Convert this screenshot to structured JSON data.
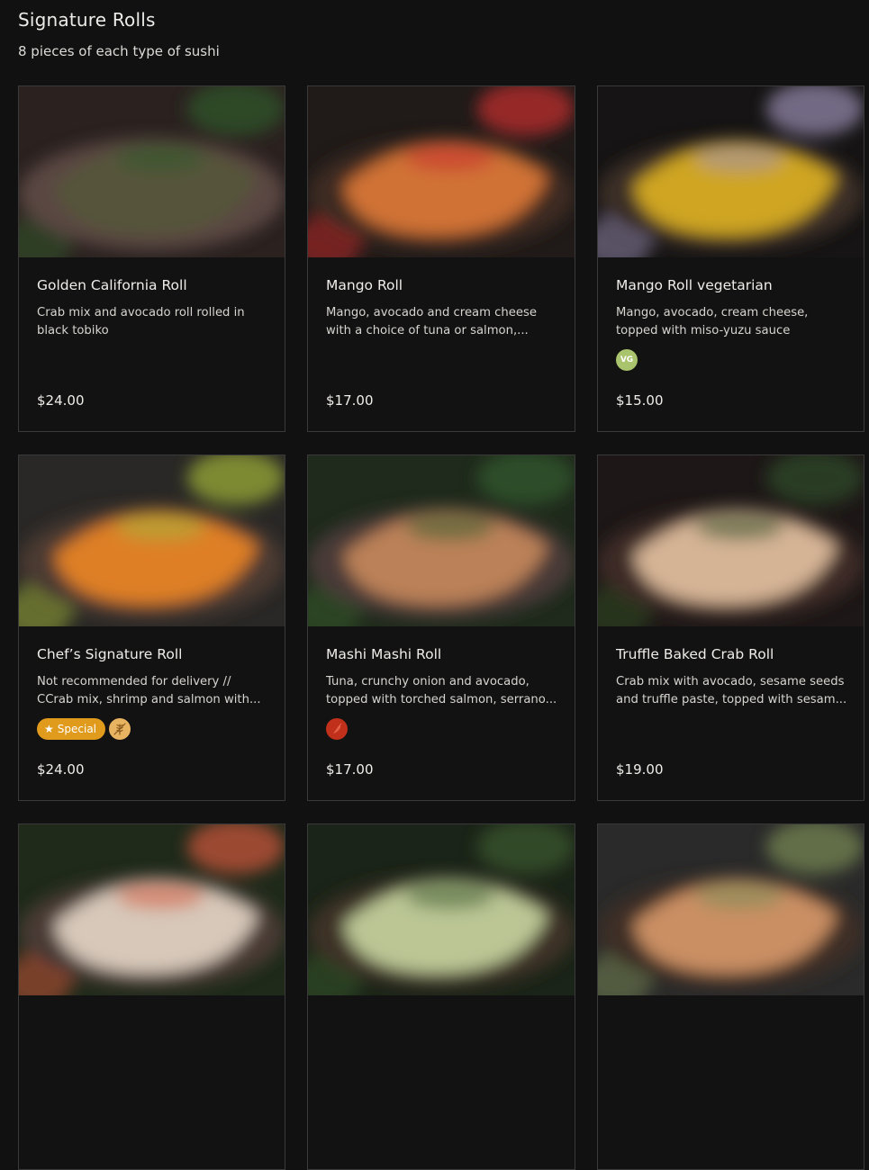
{
  "section": {
    "title": "Signature Rolls",
    "subtitle": "8 pieces of each type of sushi"
  },
  "items": [
    {
      "name": "Golden California Roll",
      "description": "Crab mix and avocado roll rolled in black tobiko",
      "price": "$24.00",
      "badges": [],
      "photo": {
        "bg": "#2b2220",
        "plate": "#5a4743",
        "food": "#57573a",
        "accent": "#2f5a2a"
      }
    },
    {
      "name": "Mango Roll",
      "description": "Mango, avocado and cream cheese with a choice of tuna or salmon,...",
      "price": "$17.00",
      "badges": [],
      "photo": {
        "bg": "#201b19",
        "plate": "#3d2a22",
        "food": "#e07a36",
        "accent": "#c92e2e"
      }
    },
    {
      "name": "Mango Roll vegetarian",
      "description": "Mango, avocado, cream cheese, topped with miso-yuzu sauce",
      "price": "$15.00",
      "badges": [
        {
          "type": "vg",
          "label": "VG",
          "icon": "vegetarian-icon"
        }
      ],
      "photo": {
        "bg": "#161414",
        "plate": "#3a2e28",
        "food": "#e0b322",
        "accent": "#9a8fb4"
      }
    },
    {
      "name": "Chef’s Signature Roll",
      "description": "Not recommended for delivery // CCrab mix, shrimp and salmon with...",
      "price": "$24.00",
      "badges": [
        {
          "type": "special",
          "label": "Special",
          "icon": "star-icon"
        },
        {
          "type": "gluten",
          "label": "",
          "icon": "wheat-icon"
        }
      ],
      "photo": {
        "bg": "#2a2826",
        "plate": "#4b3a32",
        "food": "#ee8727",
        "accent": "#a2b337"
      }
    },
    {
      "name": "Mashi Mashi Roll",
      "description": "Tuna, crunchy onion and avocado, topped with torched salmon, serrano...",
      "price": "$17.00",
      "badges": [
        {
          "type": "spicy",
          "label": "",
          "icon": "chili-pepper-icon"
        }
      ],
      "photo": {
        "bg": "#1f2a1c",
        "plate": "#4a3a38",
        "food": "#c88a5c",
        "accent": "#355c2c"
      }
    },
    {
      "name": "Truffle Baked Crab Roll",
      "description": "Crab mix with avocado, sesame seeds and truffle paste, topped with sesam...",
      "price": "$19.00",
      "badges": [],
      "photo": {
        "bg": "#1d1817",
        "plate": "#3e2b25",
        "food": "#e6c3a2",
        "accent": "#2f4d26"
      }
    },
    {
      "name": "",
      "description": "",
      "price": "",
      "badges": [],
      "photo": {
        "bg": "#1f2a1b",
        "plate": "#4a3a34",
        "food": "#e7d8c8",
        "accent": "#d2573a"
      }
    },
    {
      "name": "",
      "description": "",
      "price": "",
      "badges": [],
      "photo": {
        "bg": "#1b2418",
        "plate": "#3d3128",
        "food": "#c9d7a0",
        "accent": "#3a5a2e"
      }
    },
    {
      "name": "",
      "description": "",
      "price": "",
      "badges": [],
      "photo": {
        "bg": "#2a2a2a",
        "plate": "#3c2d25",
        "food": "#d99a6c",
        "accent": "#7a8c55"
      }
    }
  ]
}
